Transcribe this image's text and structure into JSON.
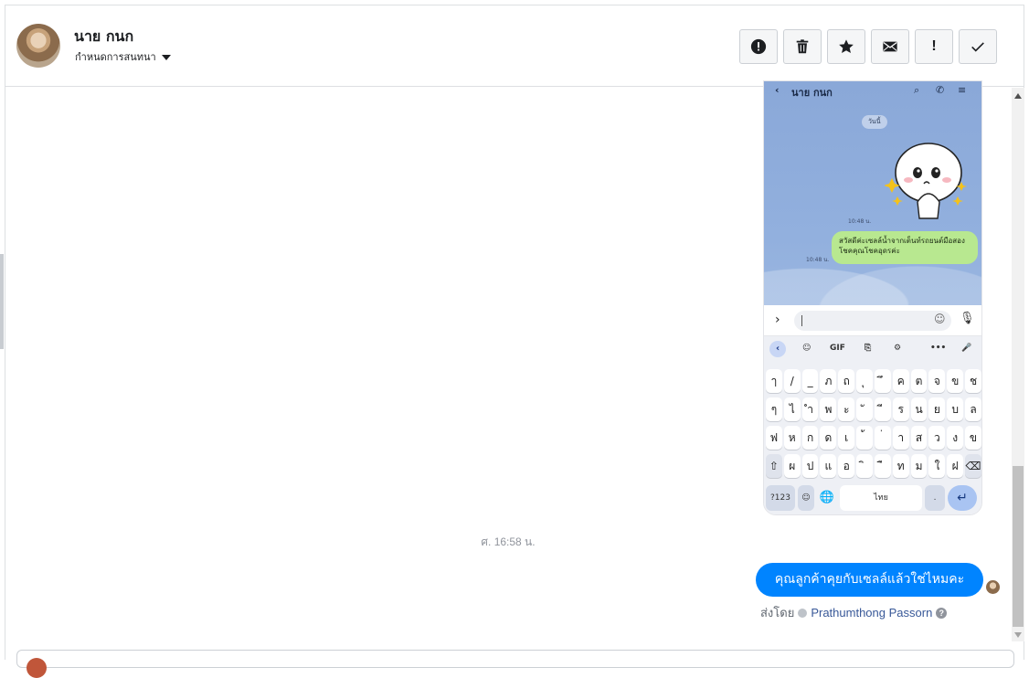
{
  "header": {
    "contact_name": "นาย กนก",
    "subtitle": "กำหนดการสนทนา",
    "toolbar": [
      {
        "name": "report-button",
        "icon": "alert-circle-icon"
      },
      {
        "name": "delete-button",
        "icon": "trash-icon"
      },
      {
        "name": "star-button",
        "icon": "star-icon"
      },
      {
        "name": "mark-unread-button",
        "icon": "envelope-icon"
      },
      {
        "name": "important-button",
        "icon": "exclamation-icon",
        "glyph": "!"
      },
      {
        "name": "mark-done-button",
        "icon": "check-icon"
      }
    ]
  },
  "attachment": {
    "contact_title": "นาย กนก",
    "day_label": "วันนี้",
    "time_sticker": "10:48 น.",
    "time_message": "10:48 น.",
    "message_text": "สวัสดีค่ะเซลล์น้ำจากเต็นท์รถยนต์มือสองโชคคุณโชคอุดรค่ะ",
    "keyboard": {
      "tools": [
        "GIF",
        "•••"
      ],
      "row1": [
        "ๅ",
        "/",
        "_",
        "ภ",
        "ถ",
        "ุ",
        "ึ",
        "ค",
        "ต",
        "จ",
        "ข",
        "ช"
      ],
      "row2": [
        "ๆ",
        "ไ",
        "ำ",
        "พ",
        "ะ",
        "ั",
        "ี",
        "ร",
        "น",
        "ย",
        "บ",
        "ล"
      ],
      "row3": [
        "ฟ",
        "ห",
        "ก",
        "ด",
        "เ",
        "้",
        "่",
        "า",
        "ส",
        "ว",
        "ง",
        "ข"
      ],
      "row4": [
        "⇧",
        "ผ",
        "ป",
        "แ",
        "อ",
        "ิ",
        "ื",
        "ท",
        "ม",
        "ใ",
        "ฝ",
        "⌫"
      ],
      "num_key": "?123",
      "space_label": "ไทย",
      "period": "."
    }
  },
  "messages": {
    "timestamp": "ศ. 16:58 น.",
    "outgoing_text": "คุณลูกค้าคุยกับเซลล์แล้วใช่ไหมคะ",
    "sent_by_label": "ส่งโดย",
    "sent_by_name": "Prathumthong Passorn"
  },
  "colors": {
    "bubble": "#0084ff",
    "link": "#385898"
  }
}
